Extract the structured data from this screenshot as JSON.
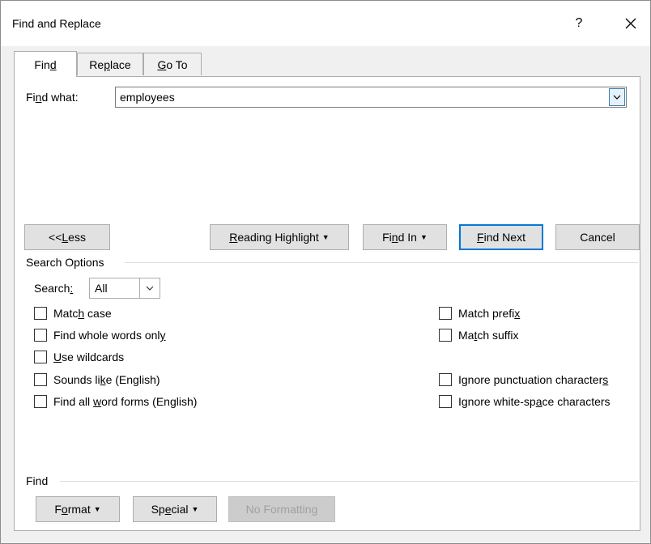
{
  "window": {
    "title": "Find and Replace",
    "help_glyph": "?",
    "close_glyph": "×"
  },
  "tabs": [
    {
      "label_pre": "Fin",
      "label_u": "d",
      "label_post": ""
    },
    {
      "label_pre": "Re",
      "label_u": "p",
      "label_post": "lace"
    },
    {
      "label_pre": "",
      "label_u": "G",
      "label_post": "o To"
    }
  ],
  "find": {
    "label_pre": "Fi",
    "label_u": "n",
    "label_post": "d what:",
    "value": "employees"
  },
  "buttons": {
    "less": {
      "pre": "<< ",
      "u": "L",
      "post": "ess"
    },
    "reading": {
      "pre": "",
      "u": "R",
      "post": "eading Highlight"
    },
    "find_in": {
      "pre": "Fi",
      "u": "n",
      "post": "d In"
    },
    "find_next": {
      "pre": "",
      "u": "F",
      "post": "ind Next"
    },
    "cancel": "Cancel"
  },
  "search_options": {
    "heading": "Search Options",
    "search_label_pre": "Search",
    "search_label_u": ":",
    "search_value": "All",
    "left": [
      {
        "pre": "Matc",
        "u": "h",
        "post": " case",
        "checked": false
      },
      {
        "pre": "Find whole words onl",
        "u": "y",
        "post": "",
        "checked": false
      },
      {
        "pre": "",
        "u": "U",
        "post": "se wildcards",
        "checked": false
      },
      {
        "pre": "Sounds li",
        "u": "k",
        "post": "e (English)",
        "checked": false
      },
      {
        "pre": "Find all ",
        "u": "w",
        "post": "ord forms (English)",
        "checked": false
      }
    ],
    "right": [
      {
        "pre": "Match prefi",
        "u": "x",
        "post": "",
        "checked": false
      },
      {
        "pre": "Ma",
        "u": "t",
        "post": "ch suffix",
        "checked": false
      },
      {
        "pre": "Ignore punctuation character",
        "u": "s",
        "post": "",
        "checked": false
      },
      {
        "pre": "Ignore white-sp",
        "u": "a",
        "post": "ce characters",
        "checked": false
      }
    ]
  },
  "find_section": {
    "heading": "Find",
    "format": {
      "pre": "F",
      "u": "o",
      "post": "rmat"
    },
    "special": {
      "pre": "Sp",
      "u": "e",
      "post": "cial"
    },
    "no_formatting": "No Formatting"
  }
}
